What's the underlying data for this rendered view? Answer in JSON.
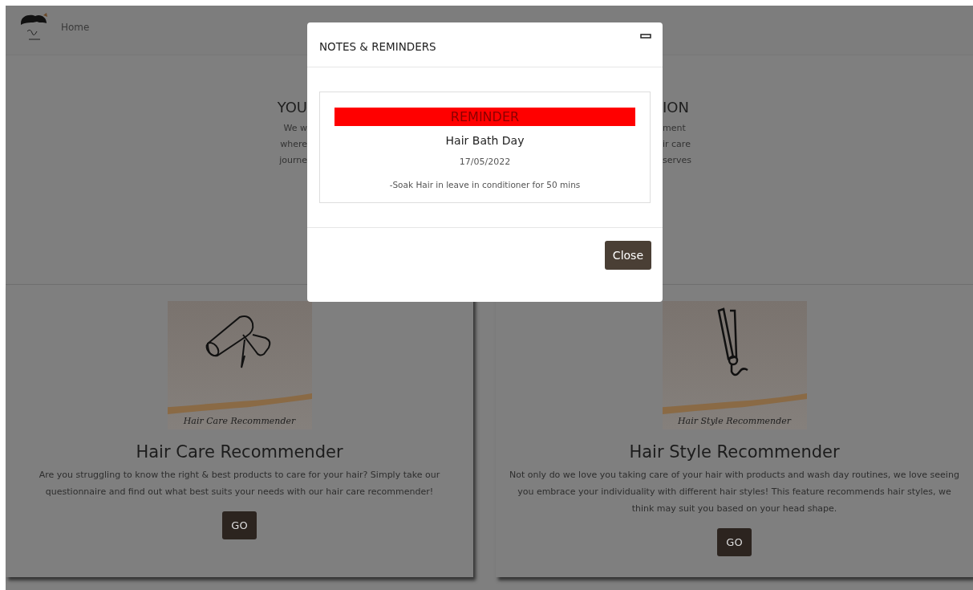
{
  "navbar": {
    "links": [
      {
        "label": "Home"
      }
    ]
  },
  "hero": {
    "left": {
      "heading": "YOU",
      "lines": [
        "We w",
        "where",
        "journe"
      ]
    },
    "right": {
      "heading": "ION",
      "lines": [
        "ment",
        "ir care",
        "serves"
      ]
    }
  },
  "cards": [
    {
      "kind": "dryer",
      "caption": "Hair Care Recommender",
      "title": "Hair Care Recommender",
      "description": "Are you struggling to know the right & best products to care for your hair? Simply take our questionnaire and find out what best suits your needs with our hair care recommender!",
      "button": "GO"
    },
    {
      "kind": "straightener",
      "caption": "Hair Style Recommender",
      "title": "Hair Style Recommender",
      "description": "Not only do we love you taking care of your hair with products and wash day routines, we love seeing you embrace your individuality with different hair styles! This feature recommends hair styles, we think may suit you based on your head shape.",
      "button": "GO"
    }
  ],
  "modal": {
    "title": "NOTES & REMINDERS",
    "reminder": {
      "badge": "REMINDER",
      "title": "Hair Bath Day",
      "date": "17/05/2022",
      "note": "-Soak Hair in leave in conditioner for 50 mins"
    },
    "button": "Close"
  }
}
